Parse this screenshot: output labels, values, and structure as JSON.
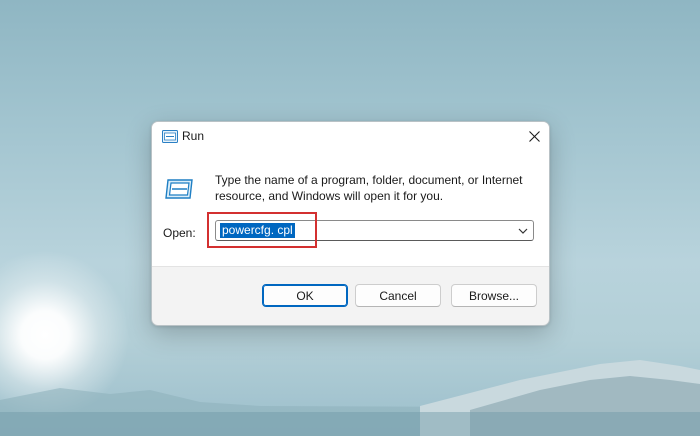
{
  "dialog": {
    "title": "Run",
    "description": "Type the name of a program, folder, document, or Internet resource, and Windows will open it for you.",
    "open_label": "Open:",
    "open_value": "powercfg. cpl",
    "buttons": {
      "ok": "OK",
      "cancel": "Cancel",
      "browse": "Browse..."
    }
  },
  "colors": {
    "accent": "#0067c0",
    "highlight_box": "#d33030"
  },
  "icons": [
    "run-icon",
    "close-icon",
    "run-large-icon",
    "chevron-down-icon"
  ]
}
